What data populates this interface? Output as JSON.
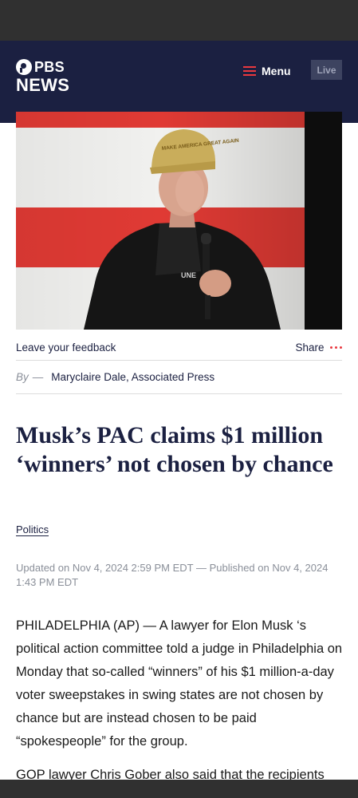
{
  "header": {
    "logo_top": "PBS",
    "logo_bottom": "NEWS",
    "menu_label": "Menu",
    "live_label": "Live"
  },
  "hero": {
    "cap_text": "MAKE AMERICA GREAT AGAIN"
  },
  "feedback": {
    "feedback_label": "Leave your feedback",
    "share_label": "Share"
  },
  "byline": {
    "by_label": "By",
    "dash": "—",
    "author": "Maryclaire Dale, Associated Press"
  },
  "article": {
    "headline": "Musk’s PAC claims $1 million ‘winners’ not chosen by chance",
    "category": "Politics",
    "dates": "Updated on Nov 4, 2024 2:59 PM EDT — Published on Nov 4, 2024 1:43 PM EDT",
    "paragraphs": [
      "PHILADELPHIA (AP) — A lawyer for Elon Musk ‘s political action committee told a judge in Philadelphia on Monday that so-called “winners” of his $1 million-a-day voter sweepstakes in swing states are not chosen by chance but are instead chosen to be paid “spokespeople” for the group.",
      "GOP lawyer Chris Gober also said that the recipients"
    ]
  },
  "colors": {
    "navy": "#1b2041",
    "accent_red": "#e9383f",
    "chrome": "#303030",
    "muted": "#8a8f99"
  },
  "icons": {
    "menu": "hamburger-icon",
    "share": "more-dots-icon",
    "logo": "pbs-head-icon"
  }
}
